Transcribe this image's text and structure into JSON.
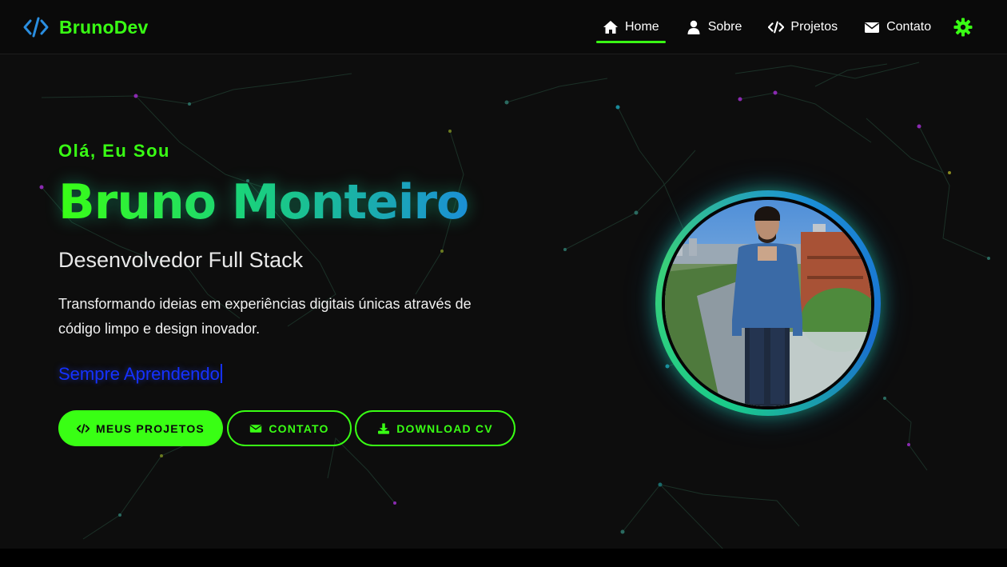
{
  "brand": {
    "name": "BrunoDev",
    "icon": "code-icon"
  },
  "nav": {
    "items": [
      {
        "label": "Home",
        "icon": "home-icon",
        "active": true
      },
      {
        "label": "Sobre",
        "icon": "user-icon",
        "active": false
      },
      {
        "label": "Projetos",
        "icon": "code-icon",
        "active": false
      },
      {
        "label": "Contato",
        "icon": "envelope-icon",
        "active": false
      }
    ],
    "settings_icon": "gear-icon"
  },
  "hero": {
    "greeting": "Olá, Eu Sou",
    "name": "Bruno Monteiro",
    "role": "Desenvolvedor Full Stack",
    "description": "Transformando ideias em experiências digitais únicas através de código limpo e design inovador.",
    "typing_text": "Sempre Aprendendo",
    "buttons": {
      "projects": "MEUS PROJETOS",
      "contact": "CONTATO",
      "download_cv": "DOWNLOAD CV"
    }
  },
  "colors": {
    "accent": "#39ff14",
    "background": "#0d0d0d",
    "typing": "#1531ff",
    "ring_blue": "#1b8fd6",
    "ring_green": "#1acb8a"
  }
}
